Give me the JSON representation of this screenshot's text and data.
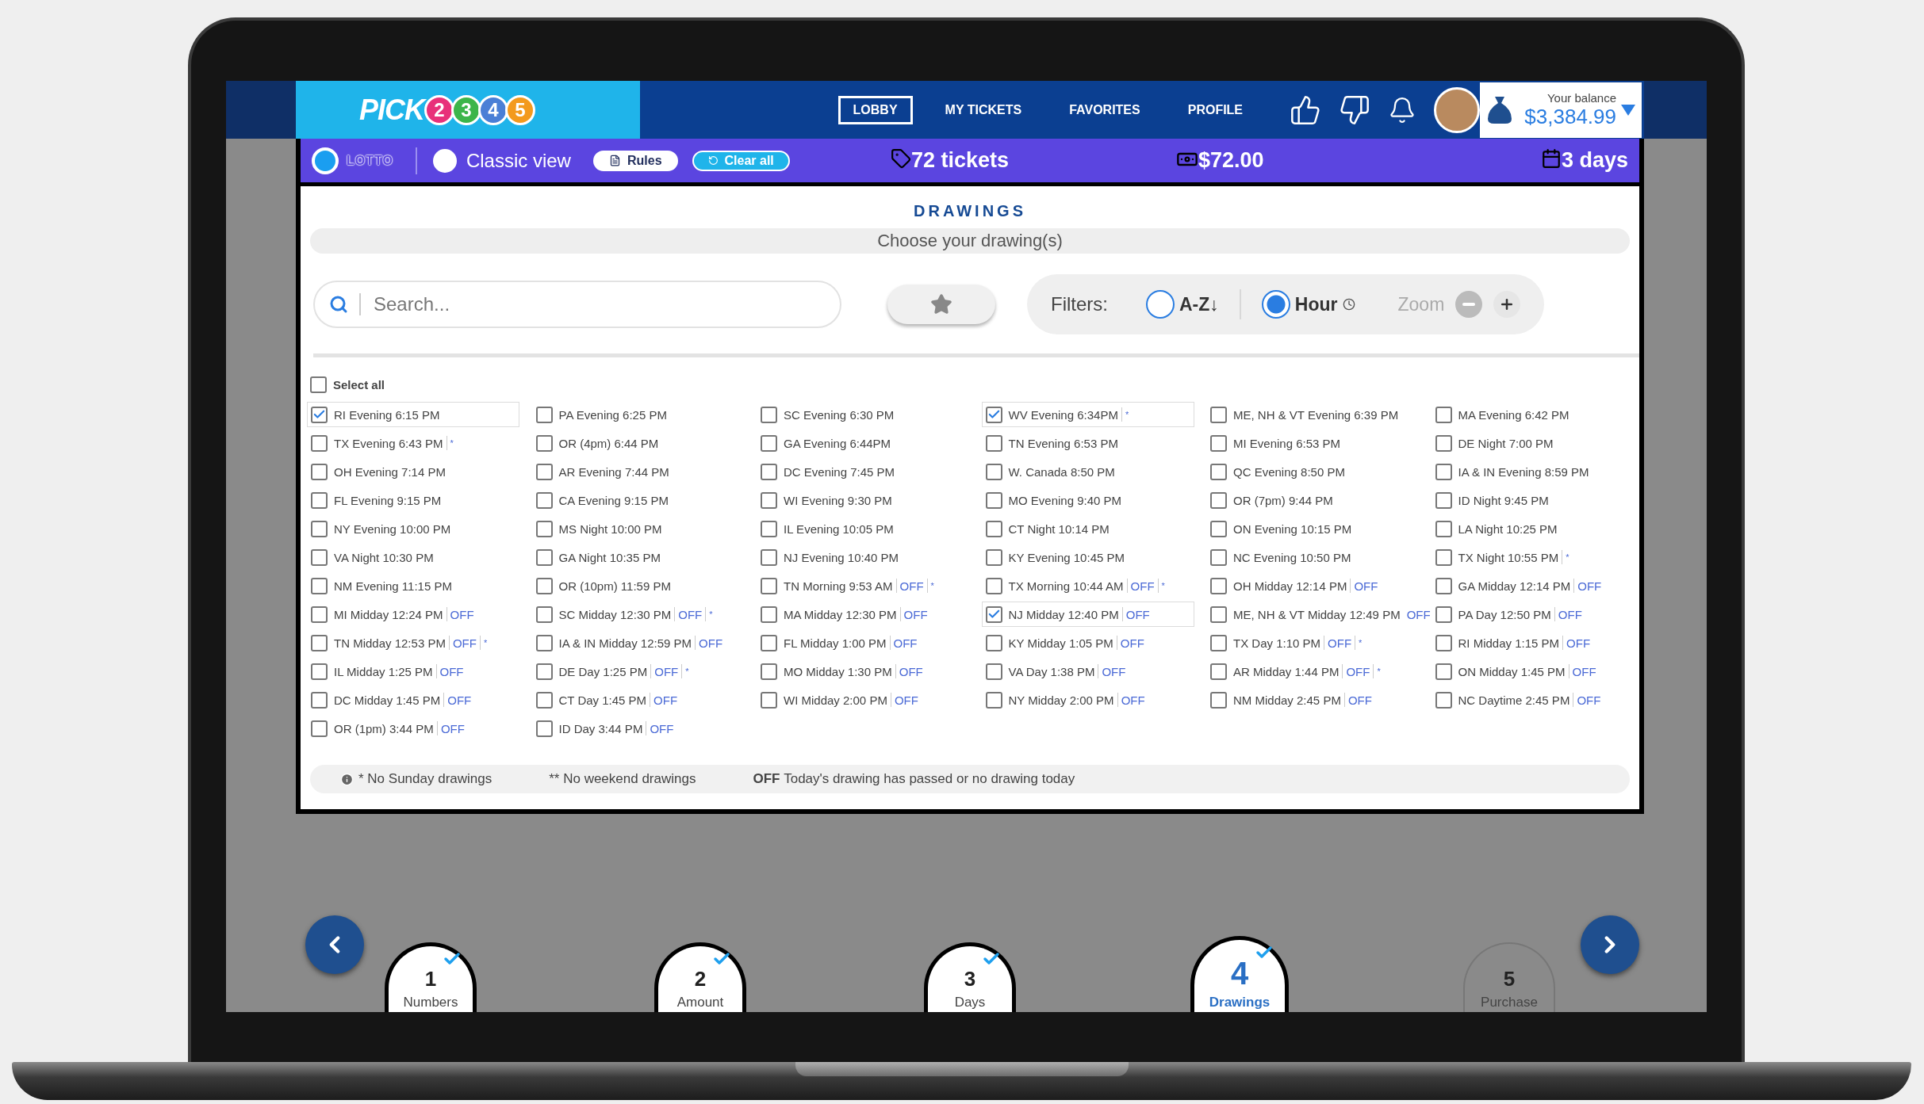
{
  "header": {
    "logo": {
      "word": "PICK",
      "balls": [
        {
          "digit": "2",
          "color": "#e8317a"
        },
        {
          "digit": "3",
          "color": "#3cb54a"
        },
        {
          "digit": "4",
          "color": "#4a7fd6"
        },
        {
          "digit": "5",
          "color": "#f39a1e"
        }
      ]
    },
    "nav": [
      {
        "label": "LOBBY",
        "selected": true
      },
      {
        "label": "MY TICKETS",
        "selected": false
      },
      {
        "label": "FAVORITES",
        "selected": false
      },
      {
        "label": "PROFILE",
        "selected": false
      }
    ],
    "balance": {
      "label": "Your balance",
      "amount": "$3,384.99"
    }
  },
  "subbar": {
    "views": [
      {
        "kind": "logo",
        "label": "LOTTO",
        "selected": true
      },
      {
        "kind": "text",
        "label": "Classic view",
        "selected": false
      }
    ],
    "buttons": [
      {
        "kind": "rules",
        "label": "Rules"
      },
      {
        "kind": "clear",
        "label": "Clear all"
      }
    ],
    "stats": [
      {
        "kind": "tickets",
        "value": "72 tickets"
      },
      {
        "kind": "money",
        "value": "$72.00"
      },
      {
        "kind": "calendar",
        "value": "3 days"
      }
    ]
  },
  "drawings": {
    "title": "DRAWINGS",
    "subtitle": "Choose your drawing(s)",
    "search": {
      "placeholder": "Search..."
    },
    "filters": {
      "label": "Filters:",
      "options": [
        {
          "kind": "az",
          "label": "A-Z↓",
          "selected": false
        },
        {
          "kind": "hour",
          "label": "Hour",
          "selected": true
        }
      ],
      "zoom": "Zoom"
    },
    "select_all": {
      "label": "Select all",
      "checked": false
    },
    "items": [
      {
        "label": "RI Evening 6:15 PM",
        "checked": true
      },
      {
        "label": "PA Evening 6:25 PM",
        "checked": false
      },
      {
        "label": "SC Evening 6:30 PM",
        "checked": false
      },
      {
        "label": "WV Evening 6:34PM",
        "checked": true,
        "note": "*"
      },
      {
        "label": "ME, NH & VT Evening 6:39 PM",
        "checked": false
      },
      {
        "label": "MA Evening 6:42 PM",
        "checked": false
      },
      {
        "label": "TX Evening 6:43 PM",
        "checked": false,
        "note": "*"
      },
      {
        "label": "OR (4pm) 6:44 PM",
        "checked": false
      },
      {
        "label": "GA Evening 6:44PM",
        "checked": false
      },
      {
        "label": "TN Evening 6:53 PM",
        "checked": false
      },
      {
        "label": "MI Evening 6:53 PM",
        "checked": false
      },
      {
        "label": "DE Night 7:00 PM",
        "checked": false
      },
      {
        "label": "OH Evening 7:14 PM",
        "checked": false
      },
      {
        "label": "AR Evening 7:44 PM",
        "checked": false
      },
      {
        "label": "DC Evening 7:45 PM",
        "checked": false
      },
      {
        "label": "W. Canada 8:50 PM",
        "checked": false
      },
      {
        "label": "QC Evening 8:50 PM",
        "checked": false
      },
      {
        "label": "IA & IN Evening 8:59 PM",
        "checked": false
      },
      {
        "label": "FL Evening 9:15 PM",
        "checked": false
      },
      {
        "label": "CA Evening 9:15 PM",
        "checked": false
      },
      {
        "label": "WI Evening 9:30 PM",
        "checked": false
      },
      {
        "label": "MO Evening 9:40 PM",
        "checked": false
      },
      {
        "label": "OR (7pm) 9:44 PM",
        "checked": false
      },
      {
        "label": "ID Night 9:45 PM",
        "checked": false
      },
      {
        "label": "NY Evening 10:00 PM",
        "checked": false
      },
      {
        "label": "MS Night 10:00 PM",
        "checked": false
      },
      {
        "label": "IL Evening 10:05 PM",
        "checked": false
      },
      {
        "label": "CT Night 10:14 PM",
        "checked": false
      },
      {
        "label": "ON Evening 10:15 PM",
        "checked": false
      },
      {
        "label": "LA Night 10:25 PM",
        "checked": false
      },
      {
        "label": "VA Night 10:30 PM",
        "checked": false
      },
      {
        "label": "GA Night 10:35 PM",
        "checked": false
      },
      {
        "label": "NJ Evening 10:40 PM",
        "checked": false
      },
      {
        "label": "KY Evening 10:45 PM",
        "checked": false
      },
      {
        "label": "NC Evening 10:50 PM",
        "checked": false
      },
      {
        "label": "TX Night 10:55 PM",
        "checked": false,
        "note": "*"
      },
      {
        "label": "NM Evening 11:15 PM",
        "checked": false
      },
      {
        "label": "OR (10pm) 11:59 PM",
        "checked": false
      },
      {
        "label": "TN Morning 9:53 AM",
        "checked": false,
        "off": "OFF",
        "note": "*"
      },
      {
        "label": "TX Morning 10:44 AM",
        "checked": false,
        "off": "OFF",
        "note": "*"
      },
      {
        "label": "OH Midday 12:14 PM",
        "checked": false,
        "off": "OFF"
      },
      {
        "label": "GA Midday 12:14 PM",
        "checked": false,
        "off": "OFF"
      },
      {
        "label": "MI Midday 12:24 PM",
        "checked": false,
        "off": "OFF"
      },
      {
        "label": "SC Midday 12:30 PM",
        "checked": false,
        "off": "OFF",
        "note": "*"
      },
      {
        "label": "MA Midday 12:30 PM",
        "checked": false,
        "off": "OFF"
      },
      {
        "label": "NJ Midday 12:40 PM",
        "checked": true,
        "off": "OFF"
      },
      {
        "label": "ME, NH & VT Midday 12:49 PM",
        "checked": false,
        "off": "OFF"
      },
      {
        "label": "PA Day 12:50 PM",
        "checked": false,
        "off": "OFF"
      },
      {
        "label": "TN Midday 12:53 PM",
        "checked": false,
        "off": "OFF",
        "note": "*"
      },
      {
        "label": "IA & IN Midday 12:59 PM",
        "checked": false,
        "off": "OFF"
      },
      {
        "label": "FL Midday 1:00 PM",
        "checked": false,
        "off": "OFF"
      },
      {
        "label": "KY Midday 1:05 PM",
        "checked": false,
        "off": "OFF"
      },
      {
        "label": "TX Day 1:10 PM",
        "checked": false,
        "off": "OFF",
        "note": "*"
      },
      {
        "label": "RI Midday 1:15 PM",
        "checked": false,
        "off": "OFF"
      },
      {
        "label": "IL Midday 1:25 PM",
        "checked": false,
        "off": "OFF"
      },
      {
        "label": "DE Day 1:25 PM",
        "checked": false,
        "off": "OFF",
        "note": "*"
      },
      {
        "label": "MO Midday 1:30 PM",
        "checked": false,
        "off": "OFF"
      },
      {
        "label": "VA Day 1:38 PM",
        "checked": false,
        "off": "OFF"
      },
      {
        "label": "AR Midday 1:44 PM",
        "checked": false,
        "off": "OFF",
        "note": "*"
      },
      {
        "label": "ON Midday 1:45 PM",
        "checked": false,
        "off": "OFF"
      },
      {
        "label": "DC Midday 1:45 PM",
        "checked": false,
        "off": "OFF"
      },
      {
        "label": "CT Day 1:45 PM",
        "checked": false,
        "off": "OFF"
      },
      {
        "label": "WI Midday 2:00 PM",
        "checked": false,
        "off": "OFF"
      },
      {
        "label": "NY Midday 2:00 PM",
        "checked": false,
        "off": "OFF"
      },
      {
        "label": "NM Midday 2:45 PM",
        "checked": false,
        "off": "OFF"
      },
      {
        "label": "NC Daytime 2:45 PM",
        "checked": false,
        "off": "OFF"
      },
      {
        "label": "OR (1pm) 3:44 PM",
        "checked": false,
        "off": "OFF"
      },
      {
        "label": "ID Day 3:44 PM",
        "checked": false,
        "off": "OFF"
      }
    ],
    "legend": [
      {
        "kind": "info",
        "text": "* No Sunday drawings"
      },
      {
        "kind": "plain",
        "text": "** No weekend drawings"
      },
      {
        "kind": "key",
        "key": "OFF",
        "text": "Today's drawing has passed or no drawing today"
      }
    ]
  },
  "steps": [
    {
      "number": "1",
      "label": "Numbers",
      "done": true,
      "selected": false
    },
    {
      "number": "2",
      "label": "Amount",
      "done": true,
      "selected": false
    },
    {
      "number": "3",
      "label": "Days",
      "done": true,
      "selected": false
    },
    {
      "number": "4",
      "label": "Drawings",
      "done": true,
      "selected": true
    },
    {
      "number": "5",
      "label": "Purchase",
      "done": false,
      "selected": false
    }
  ]
}
